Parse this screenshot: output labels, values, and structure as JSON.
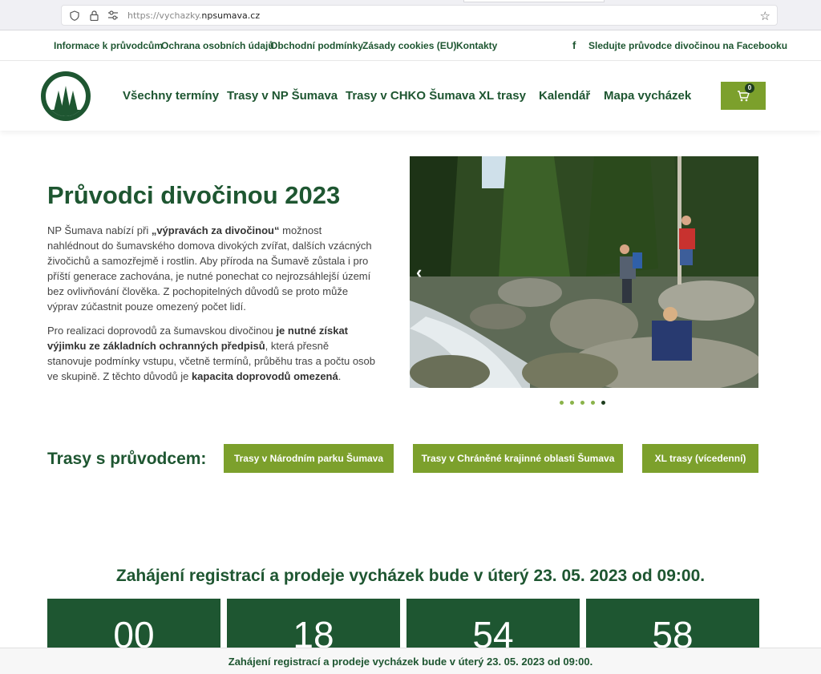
{
  "browser": {
    "url_prefix": "https://vychazky.",
    "url_domain": "npsumava.cz"
  },
  "toplinks": {
    "items": [
      {
        "label": "Informace k průvodcům"
      },
      {
        "label": "Ochrana osobních údajů"
      },
      {
        "label": "Obchodní podmínky"
      },
      {
        "label": "Zásady cookies (EU)"
      },
      {
        "label": "Kontakty"
      }
    ],
    "facebook_icon": "f",
    "facebook_label": "Sledujte průvodce divočinou na Facebooku"
  },
  "header": {
    "nav": [
      {
        "label": "Všechny termíny"
      },
      {
        "label": "Trasy v NP Šumava"
      },
      {
        "label": "Trasy v CHKO Šumava"
      },
      {
        "label": "XL trasy"
      },
      {
        "label": "Kalendář"
      },
      {
        "label": "Mapa vycházek"
      }
    ],
    "cart_count": "0",
    "accent": "#7ca02c",
    "brand": "#1e5631"
  },
  "hero": {
    "title": "Průvodci divočinou 2023",
    "p1": {
      "a": "NP Šumava nabízí při ",
      "b": "„výpravách za divočinou“",
      "c": " možnost nahlédnout do šumavského domova divokých zvířat, dalších vzácných živočichů a samozřejmě i rostlin. Aby příroda na Šumavě zůstala i pro příští generace zachována, je nutné ponechat co nejrozsáhlejší území bez ovlivňování člověka. Z pochopitelných důvodů se proto může výprav zúčastnit pouze omezený počet lidí."
    },
    "p2": {
      "a": "Pro realizaci doprovodů za šumavskou divočinou ",
      "b": "je nutné získat výjimku ze základních ochranných předpisů",
      "c": ", která přesně stanovuje podmínky vstupu, včetně termínů, průběhu tras a počtu osob ve skupině. Z těchto důvodů je ",
      "d": "kapacita doprovodů omezená",
      "e": "."
    },
    "slider_prev": "‹",
    "slide_index": 5,
    "slide_count": 5
  },
  "routes": {
    "label": "Trasy s průvodcem:",
    "buttons": [
      {
        "label": "Trasy v Národním parku Šumava"
      },
      {
        "label": "Trasy v Chráněné krajinné oblasti Šumava"
      },
      {
        "label": "XL trasy (vícedenní)"
      }
    ]
  },
  "registration": {
    "title": "Zahájení registrací a prodeje vycházek bude v úterý 23. 05. 2023 od 09:00.",
    "countdown": [
      "00",
      "18",
      "54",
      "58"
    ]
  },
  "bottom_bar": {
    "text": "Zahájení registrací a prodeje vycházek bude v úterý 23. 05. 2023 od 09:00."
  }
}
